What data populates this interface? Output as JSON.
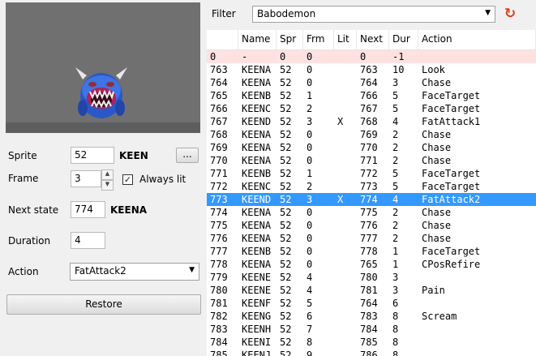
{
  "editor": {
    "sprite_label": "Sprite",
    "sprite_value": "52",
    "sprite_name": "KEEN",
    "browse_label": "...",
    "frame_label": "Frame",
    "frame_value": "3",
    "always_lit_label": "Always lit",
    "always_lit_checked": true,
    "next_state_label": "Next state",
    "next_state_value": "774",
    "next_state_name": "KEENA",
    "duration_label": "Duration",
    "duration_value": "4",
    "action_label": "Action",
    "action_value": "FatAttack2",
    "restore_label": "Restore"
  },
  "filter": {
    "label": "Filter",
    "value": "Babodemon"
  },
  "table": {
    "headers": [
      "",
      "Name",
      "Spr",
      "Frm",
      "Lit",
      "Next",
      "Dur",
      "Action"
    ],
    "rows": [
      [
        "0",
        "-",
        "0",
        "0",
        "",
        "0",
        "-1",
        ""
      ],
      [
        "763",
        "KEENA",
        "52",
        "0",
        "",
        "763",
        "10",
        "Look"
      ],
      [
        "764",
        "KEENA",
        "52",
        "0",
        "",
        "764",
        "3",
        "Chase"
      ],
      [
        "765",
        "KEENB",
        "52",
        "1",
        "",
        "766",
        "5",
        "FaceTarget"
      ],
      [
        "766",
        "KEENC",
        "52",
        "2",
        "",
        "767",
        "5",
        "FaceTarget"
      ],
      [
        "767",
        "KEEND",
        "52",
        "3",
        "X",
        "768",
        "4",
        "FatAttack1"
      ],
      [
        "768",
        "KEENA",
        "52",
        "0",
        "",
        "769",
        "2",
        "Chase"
      ],
      [
        "769",
        "KEENA",
        "52",
        "0",
        "",
        "770",
        "2",
        "Chase"
      ],
      [
        "770",
        "KEENA",
        "52",
        "0",
        "",
        "771",
        "2",
        "Chase"
      ],
      [
        "771",
        "KEENB",
        "52",
        "1",
        "",
        "772",
        "5",
        "FaceTarget"
      ],
      [
        "772",
        "KEENC",
        "52",
        "2",
        "",
        "773",
        "5",
        "FaceTarget"
      ],
      [
        "773",
        "KEEND",
        "52",
        "3",
        "X",
        "774",
        "4",
        "FatAttack2"
      ],
      [
        "774",
        "KEENA",
        "52",
        "0",
        "",
        "775",
        "2",
        "Chase"
      ],
      [
        "775",
        "KEENA",
        "52",
        "0",
        "",
        "776",
        "2",
        "Chase"
      ],
      [
        "776",
        "KEENA",
        "52",
        "0",
        "",
        "777",
        "2",
        "Chase"
      ],
      [
        "777",
        "KEENB",
        "52",
        "0",
        "",
        "778",
        "1",
        "FaceTarget"
      ],
      [
        "778",
        "KEENA",
        "52",
        "0",
        "",
        "765",
        "1",
        "CPosRefire"
      ],
      [
        "779",
        "KEENE",
        "52",
        "4",
        "",
        "780",
        "3",
        ""
      ],
      [
        "780",
        "KEENE",
        "52",
        "4",
        "",
        "781",
        "3",
        "Pain"
      ],
      [
        "781",
        "KEENF",
        "52",
        "5",
        "",
        "764",
        "6",
        ""
      ],
      [
        "782",
        "KEENG",
        "52",
        "6",
        "",
        "783",
        "8",
        "Scream"
      ],
      [
        "783",
        "KEENH",
        "52",
        "7",
        "",
        "784",
        "8",
        ""
      ],
      [
        "784",
        "KEENI",
        "52",
        "8",
        "",
        "785",
        "8",
        ""
      ],
      [
        "785",
        "KEENJ",
        "52",
        "9",
        "",
        "786",
        "8",
        ""
      ]
    ],
    "selected_row": 11,
    "zero_row": 0
  },
  "colors": {
    "selection": "#3399ff",
    "zero_row": "#fde2e2",
    "refresh": "#e0401a"
  },
  "icons": {
    "refresh": "refresh-icon",
    "dropdown": "chevron-down-icon",
    "spin_up": "spin-up-icon",
    "spin_down": "spin-down-icon"
  }
}
